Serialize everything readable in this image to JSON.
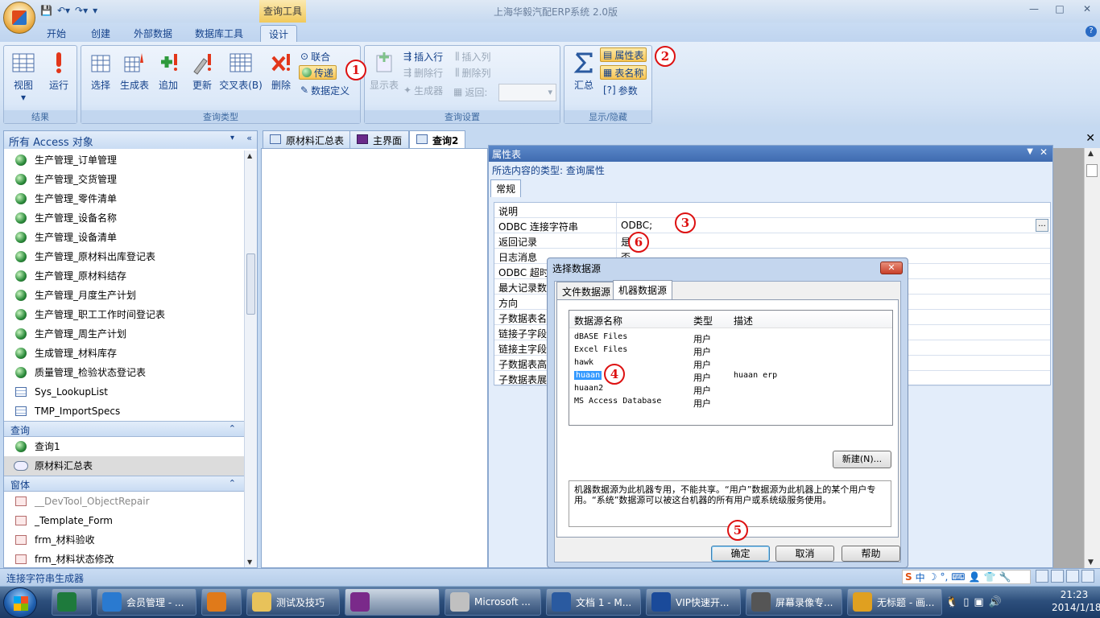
{
  "window": {
    "title": "上海华毅汽配ERP系统 2.0版",
    "context_tab_title": "查询工具",
    "controls": [
      "—",
      "□",
      "✕"
    ]
  },
  "ribbon": {
    "tabs": [
      {
        "label": "开始",
        "active": false
      },
      {
        "label": "创建",
        "active": false
      },
      {
        "label": "外部数据",
        "active": false
      },
      {
        "label": "数据库工具",
        "active": false
      },
      {
        "label": "设计",
        "active": true
      }
    ],
    "groups": {
      "results": {
        "label": "结果",
        "view": "视图",
        "run": "运行"
      },
      "query_type": {
        "label": "查询类型",
        "select": "选择",
        "make_table": "生成表",
        "append": "追加",
        "update": "更新",
        "crosstab": "交叉表(B)",
        "delete": "删除",
        "union": "联合",
        "pass_through": "传递",
        "data_definition": "数据定义"
      },
      "query_setup": {
        "label": "查询设置",
        "show_table": "显示表",
        "insert_row": "插入行",
        "delete_row": "删除行",
        "builder": "生成器",
        "insert_col": "插入列",
        "delete_col": "删除列",
        "return_label": "返回:",
        "return_value": ""
      },
      "show_hide": {
        "label": "显示/隐藏",
        "totals": "汇总",
        "property_sheet": "属性表",
        "table_names": "表名称",
        "parameters": "参数"
      }
    },
    "help": "?"
  },
  "badges": {
    "b1": "1",
    "b2": "2",
    "b3": "3",
    "b4": "4",
    "b5": "5",
    "b6": "6"
  },
  "nav": {
    "header": "所有 Access 对象",
    "items_top": [
      {
        "label": "生产管理_订单管理",
        "icon": "globe"
      },
      {
        "label": "生产管理_交货管理",
        "icon": "globe"
      },
      {
        "label": "生产管理_零件清单",
        "icon": "globe"
      },
      {
        "label": "生产管理_设备名称",
        "icon": "globe"
      },
      {
        "label": "生产管理_设备清单",
        "icon": "globe"
      },
      {
        "label": "生产管理_原材料出库登记表",
        "icon": "globe"
      },
      {
        "label": "生产管理_原材料结存",
        "icon": "globe"
      },
      {
        "label": "生产管理_月度生产计划",
        "icon": "globe"
      },
      {
        "label": "生产管理_职工工作时间登记表",
        "icon": "globe"
      },
      {
        "label": "生产管理_周生产计划",
        "icon": "globe"
      },
      {
        "label": "生成管理_材料库存",
        "icon": "globe"
      },
      {
        "label": "质量管理_检验状态登记表",
        "icon": "globe"
      },
      {
        "label": "Sys_LookupList",
        "icon": "table"
      },
      {
        "label": "TMP_ImportSpecs",
        "icon": "table"
      }
    ],
    "section_queries": "查询",
    "queries": [
      {
        "label": "查询1",
        "icon": "globe"
      },
      {
        "label": "原材料汇总表",
        "icon": "union"
      }
    ],
    "section_forms": "窗体",
    "forms": [
      {
        "label": "__DevTool_ObjectRepair"
      },
      {
        "label": "_Template_Form"
      },
      {
        "label": "frm_材料验收"
      },
      {
        "label": "frm_材料状态修改"
      }
    ]
  },
  "doc_tabs": [
    {
      "label": "原材料汇总表",
      "active": false
    },
    {
      "label": "主界面",
      "active": false
    },
    {
      "label": "查询2",
      "active": true
    }
  ],
  "property_sheet": {
    "title": "属性表",
    "selection_type": "所选内容的类型: 查询属性",
    "tab": "常规",
    "rows": [
      {
        "key": "说明",
        "value": ""
      },
      {
        "key": "ODBC 连接字符串",
        "value": "ODBC;"
      },
      {
        "key": "返回记录",
        "value": "是"
      },
      {
        "key": "日志消息",
        "value": "否"
      },
      {
        "key": "ODBC 超时",
        "value": ""
      },
      {
        "key": "最大记录数",
        "value": ""
      },
      {
        "key": "方向",
        "value": ""
      },
      {
        "key": "子数据表名称",
        "value": ""
      },
      {
        "key": "链接子字段",
        "value": ""
      },
      {
        "key": "链接主字段",
        "value": ""
      },
      {
        "key": "子数据表高度",
        "value": ""
      },
      {
        "key": "子数据表展开",
        "value": ""
      }
    ]
  },
  "dialog": {
    "title": "选择数据源",
    "tabs": [
      "文件数据源",
      "机器数据源"
    ],
    "columns": [
      "数据源名称",
      "类型",
      "描述"
    ],
    "rows": [
      {
        "name": "dBASE Files",
        "type": "用户",
        "desc": ""
      },
      {
        "name": "Excel Files",
        "type": "用户",
        "desc": ""
      },
      {
        "name": "hawk",
        "type": "用户",
        "desc": ""
      },
      {
        "name": "huaan",
        "type": "用户",
        "desc": "huaan erp"
      },
      {
        "name": "huaan2",
        "type": "用户",
        "desc": ""
      },
      {
        "name": "MS Access Database",
        "type": "用户",
        "desc": ""
      }
    ],
    "new_button": "新建(N)...",
    "description": "机器数据源为此机器专用，不能共享。“用户”数据源为此机器上的某个用户专用。“系统”数据源可以被这台机器的所有用户或系统级服务使用。",
    "ok": "确定",
    "cancel": "取消",
    "help": "帮助"
  },
  "status_bar": {
    "text": "连接字符串生成器",
    "ime": [
      "中",
      "☽",
      "°,",
      "⌨",
      "👤",
      "👕",
      "🔧"
    ]
  },
  "taskbar": {
    "buttons": [
      {
        "label": "",
        "icon": "excel",
        "active": false
      },
      {
        "label": "会员管理 - ...",
        "icon": "ie",
        "active": false
      },
      {
        "label": "",
        "icon": "media",
        "active": false
      },
      {
        "label": "测试及技巧",
        "icon": "folder",
        "active": false
      },
      {
        "label": "",
        "icon": "access",
        "active": true
      },
      {
        "label": "Microsoft ...",
        "icon": "tools",
        "active": false
      },
      {
        "label": "文档 1 - M...",
        "icon": "word",
        "active": false
      },
      {
        "label": "VIP快速开...",
        "icon": "access-logo",
        "active": false
      },
      {
        "label": "屏幕录像专...",
        "icon": "recorder",
        "active": false
      },
      {
        "label": "无标题 - 画...",
        "icon": "paint",
        "active": false
      }
    ],
    "time": "21:23",
    "date": "2014/1/18"
  },
  "colors": {
    "ribbon_text": "#15428b",
    "highlight": "#f8c452",
    "badge_red": "#dd1111",
    "selection_blue": "#3399ff"
  }
}
